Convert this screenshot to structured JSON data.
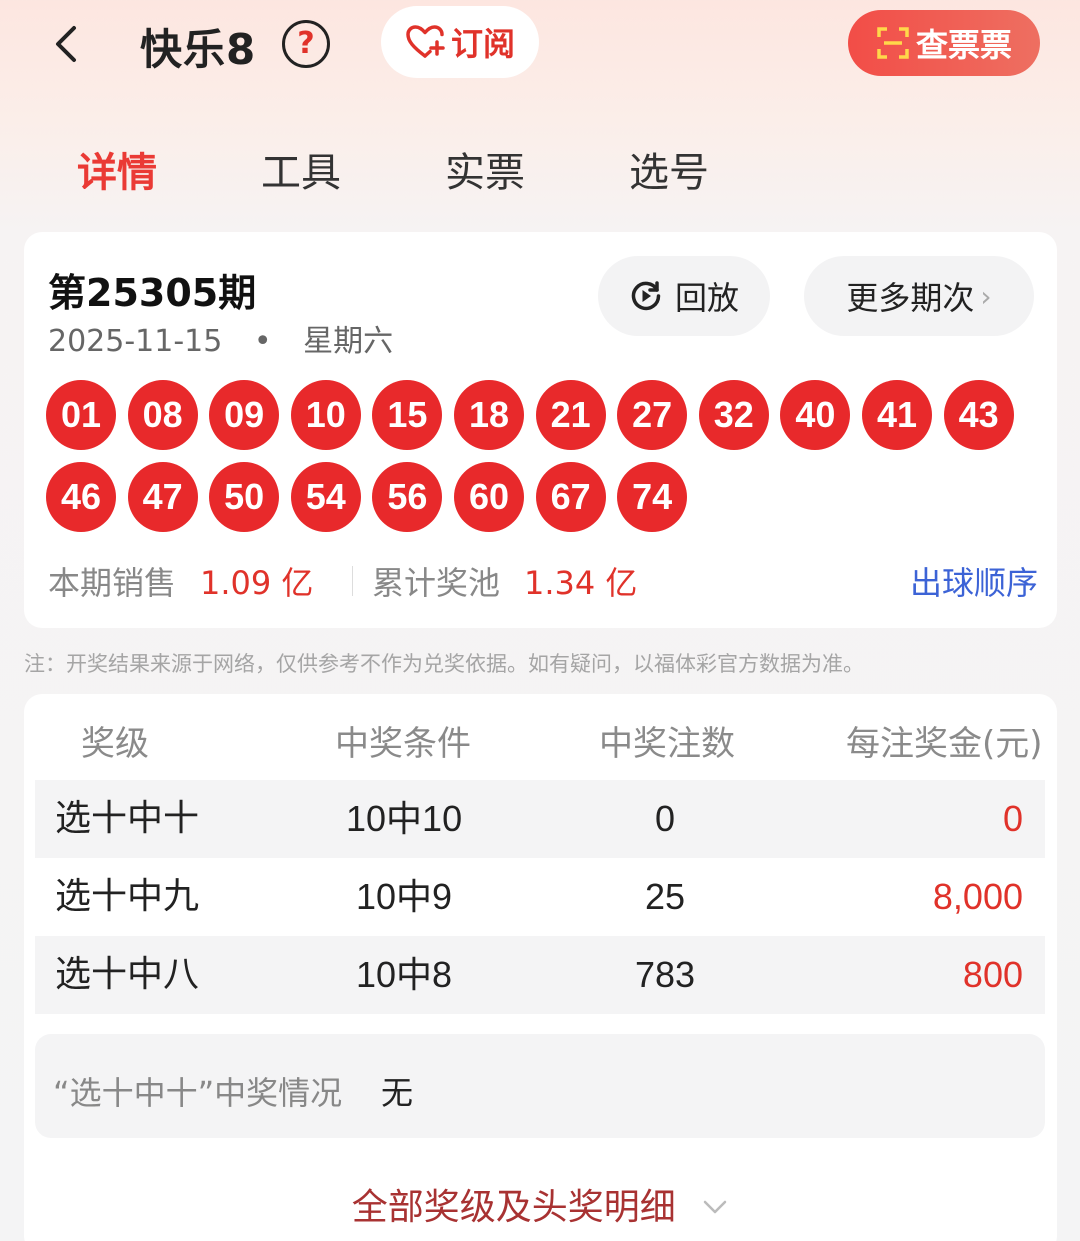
{
  "header": {
    "title": "快乐8",
    "help_label": "?",
    "subscribe_label": "订阅",
    "check_ticket_label": "查票票"
  },
  "tabs": [
    {
      "label": "详情",
      "active": true
    },
    {
      "label": "工具",
      "active": false
    },
    {
      "label": "实票",
      "active": false
    },
    {
      "label": "选号",
      "active": false
    }
  ],
  "draw": {
    "issue": "第25305期",
    "date": "2025-11-15",
    "separator": "•",
    "weekday": "星期六",
    "replay_label": "回放",
    "more_label": "更多期次",
    "numbers": [
      "01",
      "08",
      "09",
      "10",
      "15",
      "18",
      "21",
      "27",
      "32",
      "40",
      "41",
      "43",
      "46",
      "47",
      "50",
      "54",
      "56",
      "60",
      "67",
      "74"
    ],
    "sales_label": "本期销售",
    "sales_value": "1.09 亿",
    "pool_label": "累计奖池",
    "pool_value": "1.34 亿",
    "order_link": "出球顺序"
  },
  "note": "注：开奖结果来源于网络，仅供参考不作为兑奖依据。如有疑问，以福体彩官方数据为准。",
  "prize_table": {
    "headers": [
      "奖级",
      "中奖条件",
      "中奖注数",
      "每注奖金(元)"
    ],
    "rows": [
      {
        "level": "选十中十",
        "condition": "10中10",
        "count": "0",
        "amount": "0"
      },
      {
        "level": "选十中九",
        "condition": "10中9",
        "count": "25",
        "amount": "8,000"
      },
      {
        "level": "选十中八",
        "condition": "10中8",
        "count": "783",
        "amount": "800"
      }
    ],
    "jackpot_label": "“选十中十”中奖情况",
    "jackpot_value": "无",
    "all_levels_label": "全部奖级及头奖明细"
  },
  "colors": {
    "accent": "#e0322a",
    "ball": "#e8292b",
    "link": "#3c63d6",
    "footer_link": "#a83232"
  }
}
